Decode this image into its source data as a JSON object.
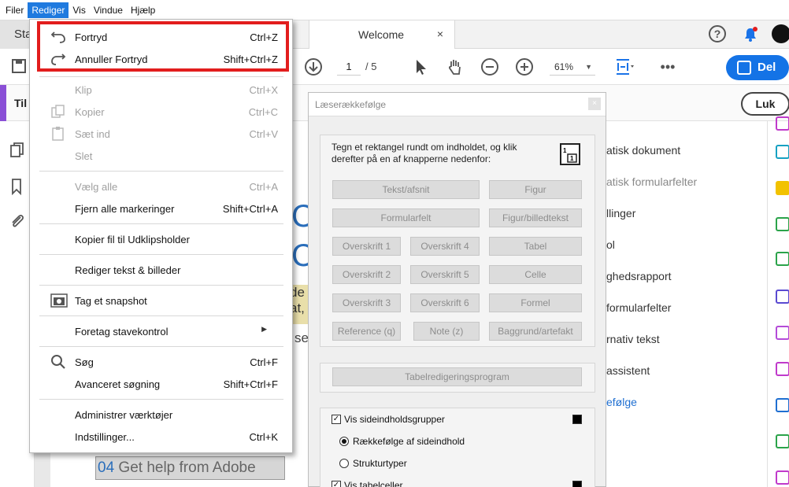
{
  "menubar": {
    "items": [
      "Filer",
      "Rediger",
      "Vis",
      "Vindue",
      "Hjælp"
    ]
  },
  "tabs": {
    "start": "Sta",
    "welcome": "Welcome",
    "close": "×"
  },
  "toolbar": {
    "page": "1",
    "of": "/ 5",
    "zoom": "61%",
    "share": "Del"
  },
  "subbar": {
    "tools_label": "Til",
    "close": "Luk"
  },
  "menu": {
    "undo": {
      "label": "Fortryd",
      "shortcut": "Ctrl+Z"
    },
    "redo": {
      "label": "Annuller Fortryd",
      "shortcut": "Shift+Ctrl+Z"
    },
    "cut": {
      "label": "Klip",
      "shortcut": "Ctrl+X"
    },
    "copy": {
      "label": "Kopier",
      "shortcut": "Ctrl+C"
    },
    "paste": {
      "label": "Sæt ind",
      "shortcut": "Ctrl+V"
    },
    "delete": {
      "label": "Slet"
    },
    "select_all": {
      "label": "Vælg alle",
      "shortcut": "Ctrl+A"
    },
    "deselect_all": {
      "label": "Fjern alle markeringer",
      "shortcut": "Shift+Ctrl+A"
    },
    "copy_file": {
      "label": "Kopier fil til Udklipsholder"
    },
    "edit_text": {
      "label": "Rediger tekst & billeder"
    },
    "snapshot": {
      "label": "Tag et snapshot"
    },
    "spellcheck": {
      "label": "Foretag stavekontrol"
    },
    "search": {
      "label": "Søg",
      "shortcut": "Ctrl+F"
    },
    "advanced_search": {
      "label": "Avanceret søgning",
      "shortcut": "Shift+Ctrl+F"
    },
    "manage_tools": {
      "label": "Administrer værktøjer"
    },
    "preferences": {
      "label": "Indstillinger...",
      "shortcut": "Ctrl+K"
    }
  },
  "dialog": {
    "title": "Læserækkefølge",
    "close": "×",
    "instructions": "Tegn et rektangel rundt om indholdet, og klik derefter på en af knapperne nedenfor:",
    "buttons": {
      "text": "Tekst/afsnit",
      "figure": "Figur",
      "form_field": "Formularfelt",
      "figure_caption": "Figur/billedtekst",
      "h1": "Overskrift 1",
      "h4": "Overskrift 4",
      "table": "Tabel",
      "h2": "Overskrift 2",
      "h5": "Overskrift 5",
      "cell": "Celle",
      "h3": "Overskrift 3",
      "h6": "Overskrift 6",
      "formula": "Formel",
      "reference": "Reference (q)",
      "note": "Note (z)",
      "background": "Baggrund/artefakt",
      "table_editor": "Tabelredigeringsprogram"
    },
    "show_groups": "Vis sideindholdsgrupper",
    "page_order": "Rækkefølge af sideindhold",
    "structure_types": "Strukturtyper",
    "show_table_cells": "Vis tabelceller"
  },
  "document": {
    "blue": "C",
    "yellow_lines": [
      "de",
      "at,",
      "se"
    ],
    "help_num": "04",
    "help_text": " Get help from Adobe"
  },
  "rightpane": {
    "items": [
      "atisk dokument",
      "atisk formularfelter",
      "llinger",
      "ol",
      "ghedsrapport",
      "formularfelter",
      "rnativ tekst",
      "assistent",
      "efølge"
    ]
  },
  "colors": {
    "accent": "#1473e6",
    "highlight": "#e21d1d",
    "menu_active": "#1f7adf",
    "purple": "#8a4fd6"
  }
}
